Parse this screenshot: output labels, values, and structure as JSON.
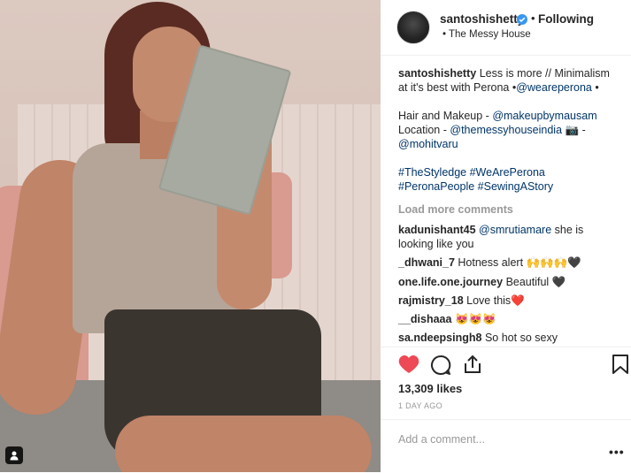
{
  "post": {
    "username": "santoshishetty",
    "follow_status": "Following",
    "separator": "•",
    "location": "• The Messy House",
    "caption": {
      "author": "santoshishetty",
      "line1_a": "Less is more // Minimalism",
      "line2_a": "at it's best with Perona •",
      "mention1": "@weareperona",
      "line2_b": " •",
      "hair_label": "Hair and Makeup - ",
      "mention2": "@makeupbymausam",
      "location_label": "Location - ",
      "mention3": "@themessyhouseindia",
      "camera": "📷",
      "dash": " -",
      "mention4": "@mohitvaru",
      "tags1": "#TheStyledge #WeArePerona",
      "tags2": "#PeronaPeople #SewingAStory"
    },
    "load_more": "Load more comments",
    "comments": [
      {
        "user": "kadunishant45",
        "mention": "@smrutiamare",
        "text": " she is",
        "text2": "looking like you"
      },
      {
        "user": "_dhwani_7",
        "text": "Hotness alert 🙌🙌🙌🖤"
      },
      {
        "user": "one.life.one.journey",
        "text": "Beautiful 🖤"
      },
      {
        "user": "rajmistry_18",
        "text": "Love this❤️"
      },
      {
        "user": "__dishaaa",
        "text": "😻😻😻"
      },
      {
        "user": "sa.ndeepsingh8",
        "text": "So hot so sexy"
      }
    ],
    "likes": "13,309 likes",
    "time_ago": "1 DAY AGO",
    "add_comment_placeholder": "Add a comment...",
    "more_options": "•••"
  },
  "colors": {
    "like_red": "#ed4956",
    "link_blue": "#003569",
    "verified_blue": "#3897f0"
  },
  "icons": [
    "heart-icon",
    "comment-icon",
    "share-icon",
    "bookmark-icon",
    "verified-icon",
    "user-tag-icon"
  ]
}
